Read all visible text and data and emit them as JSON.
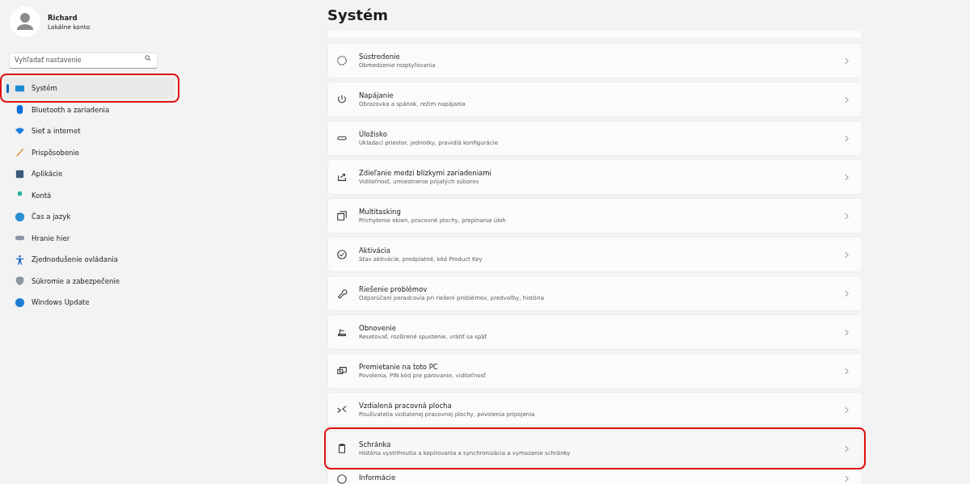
{
  "account": {
    "name": "Richard",
    "type": "Lokálne konto"
  },
  "search": {
    "placeholder": "Vyhľadať nastavenie"
  },
  "nav": [
    {
      "label": "Systém",
      "selected": true,
      "highlighted": true
    },
    {
      "label": "Bluetooth a zariadenia",
      "selected": false,
      "highlighted": false
    },
    {
      "label": "Sieť a internet",
      "selected": false,
      "highlighted": false
    },
    {
      "label": "Prispôsobenie",
      "selected": false,
      "highlighted": false
    },
    {
      "label": "Aplikácie",
      "selected": false,
      "highlighted": false
    },
    {
      "label": "Kontá",
      "selected": false,
      "highlighted": false
    },
    {
      "label": "Čas a jazyk",
      "selected": false,
      "highlighted": false
    },
    {
      "label": "Hranie hier",
      "selected": false,
      "highlighted": false
    },
    {
      "label": "Zjednodušenie ovládania",
      "selected": false,
      "highlighted": false
    },
    {
      "label": "Súkromie a zabezpečenie",
      "selected": false,
      "highlighted": false
    },
    {
      "label": "Windows Update",
      "selected": false,
      "highlighted": false
    }
  ],
  "page_title": "Systém",
  "cards": [
    {
      "title": "Sústredenie",
      "subtitle": "Obmedzenie rozptyľovania",
      "highlighted": false
    },
    {
      "title": "Napájanie",
      "subtitle": "Obrazovka a spánok, režim napájania",
      "highlighted": false
    },
    {
      "title": "Úložisko",
      "subtitle": "Ukladací priestor, jednotky, pravidlá konfigurácie",
      "highlighted": false
    },
    {
      "title": "Zdieľanie medzi blízkymi zariadeniami",
      "subtitle": "Viditeľnosť, umiestnenie prijatých súborov",
      "highlighted": false
    },
    {
      "title": "Multitasking",
      "subtitle": "Prichytenie okien, pracovné plochy, prepínanie úloh",
      "highlighted": false
    },
    {
      "title": "Aktivácia",
      "subtitle": "Stav aktivácie, predplatné, kód Product Key",
      "highlighted": false
    },
    {
      "title": "Riešenie problémov",
      "subtitle": "Odporúčaní poradcovia pri riešení problémov, predvoľby, história",
      "highlighted": false
    },
    {
      "title": "Obnovenie",
      "subtitle": "Resetovať, rozšírené spustenie, vrátiť sa späť",
      "highlighted": false
    },
    {
      "title": "Premietanie na toto PC",
      "subtitle": "Povolenia, PIN kód pre párovanie, viditeľnosť",
      "highlighted": false
    },
    {
      "title": "Vzdialená pracovná plocha",
      "subtitle": "Používatelia vzdialenej pracovnej plochy, povolenia pripojenia",
      "highlighted": false
    },
    {
      "title": "Schránka",
      "subtitle": "História vystrihnutia a kopírovania a synchronizácia a vymazanie schránky",
      "highlighted": true
    },
    {
      "title": "Informácie"
    }
  ]
}
